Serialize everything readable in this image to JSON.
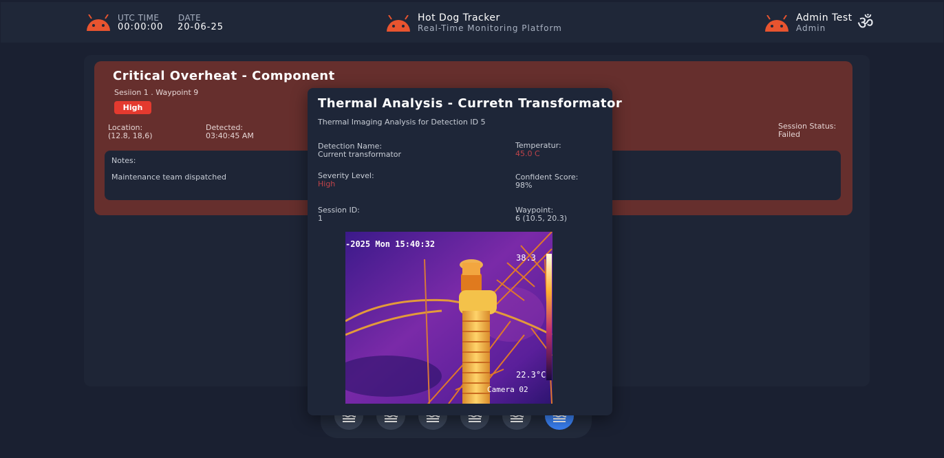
{
  "header": {
    "utc_label": "UTC TIME",
    "utc_value": "00:00:00",
    "date_label": "DATE",
    "date_value": "20-06-25",
    "app_title": "Hot Dog Tracker",
    "app_subtitle": "Real-Time Monitoring Platform",
    "user_name": "Admin Test",
    "user_role": "Admin",
    "om_symbol": "ॐ",
    "icon_color": "#e8542f"
  },
  "alert": {
    "title": "Critical Overheat - Component",
    "subtitle": "Sesiion 1 . Waypoint 9",
    "severity": "High",
    "location_label": "Location:",
    "location_value": "(12.8, 18,6)",
    "detected_label": "Detected:",
    "detected_value": "03:40:45 AM",
    "session_status_label": "Session Status:",
    "session_status_value": "Failed",
    "notes_label": "Notes:",
    "notes_text": "Maintenance team dispatched"
  },
  "modal": {
    "title": "Thermal Analysis - Curretn Transformator",
    "subtitle": "Thermal Imaging Analysis for Detection ID 5",
    "detection_name_label": "Detection Name:",
    "detection_name_value": "Current transformator",
    "temperature_label": "Temperatur:",
    "temperature_value": "45.0 C",
    "severity_label": "Severity Level:",
    "severity_value": "High",
    "confidence_label": "Confident Score:",
    "confidence_value": "98%",
    "session_label": "Session ID:",
    "session_value": "1",
    "waypoint_label": "Waypoint:",
    "waypoint_value": "6 (10.5, 20.3)",
    "image": {
      "timestamp": "-2025 Mon 15:40:32",
      "max_temp": "38.3",
      "min_temp": "22.3°C",
      "camera": "Camera 02"
    }
  },
  "dock": {
    "buttons": [
      "waves-icon",
      "waves-icon",
      "waves-icon",
      "waves-icon",
      "waves-icon",
      "waves-icon"
    ],
    "active_index": 5
  }
}
